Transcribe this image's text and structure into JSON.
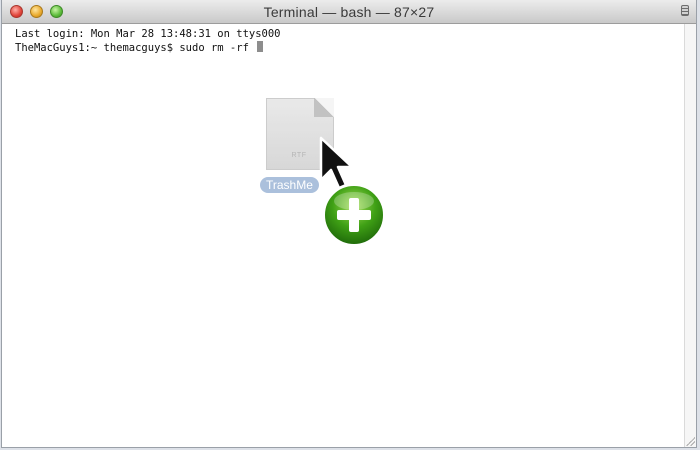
{
  "window": {
    "title": "Terminal — bash — 87×27"
  },
  "terminal": {
    "lines": [
      "Last login: Mon Mar 28 13:48:31 on ttys000",
      "TheMacGuys1:~ themacguys$ sudo rm -rf "
    ]
  },
  "drag": {
    "file_extension": "RTF",
    "file_label": "TrashMe"
  },
  "icons": {
    "close": "close-button",
    "minimize": "minimize-button",
    "zoom": "zoom-button",
    "toolbar_toggle": "toolbar-toggle-icon",
    "pointer": "arrow-pointer-icon",
    "add_badge": "add-plus-icon",
    "file": "rtf-document-icon"
  },
  "colors": {
    "close": "#e0443a",
    "minimize": "#e9a92c",
    "zoom": "#5bbb3a",
    "add_badge": "#3fa015",
    "label_highlight": "#9db6d7"
  }
}
